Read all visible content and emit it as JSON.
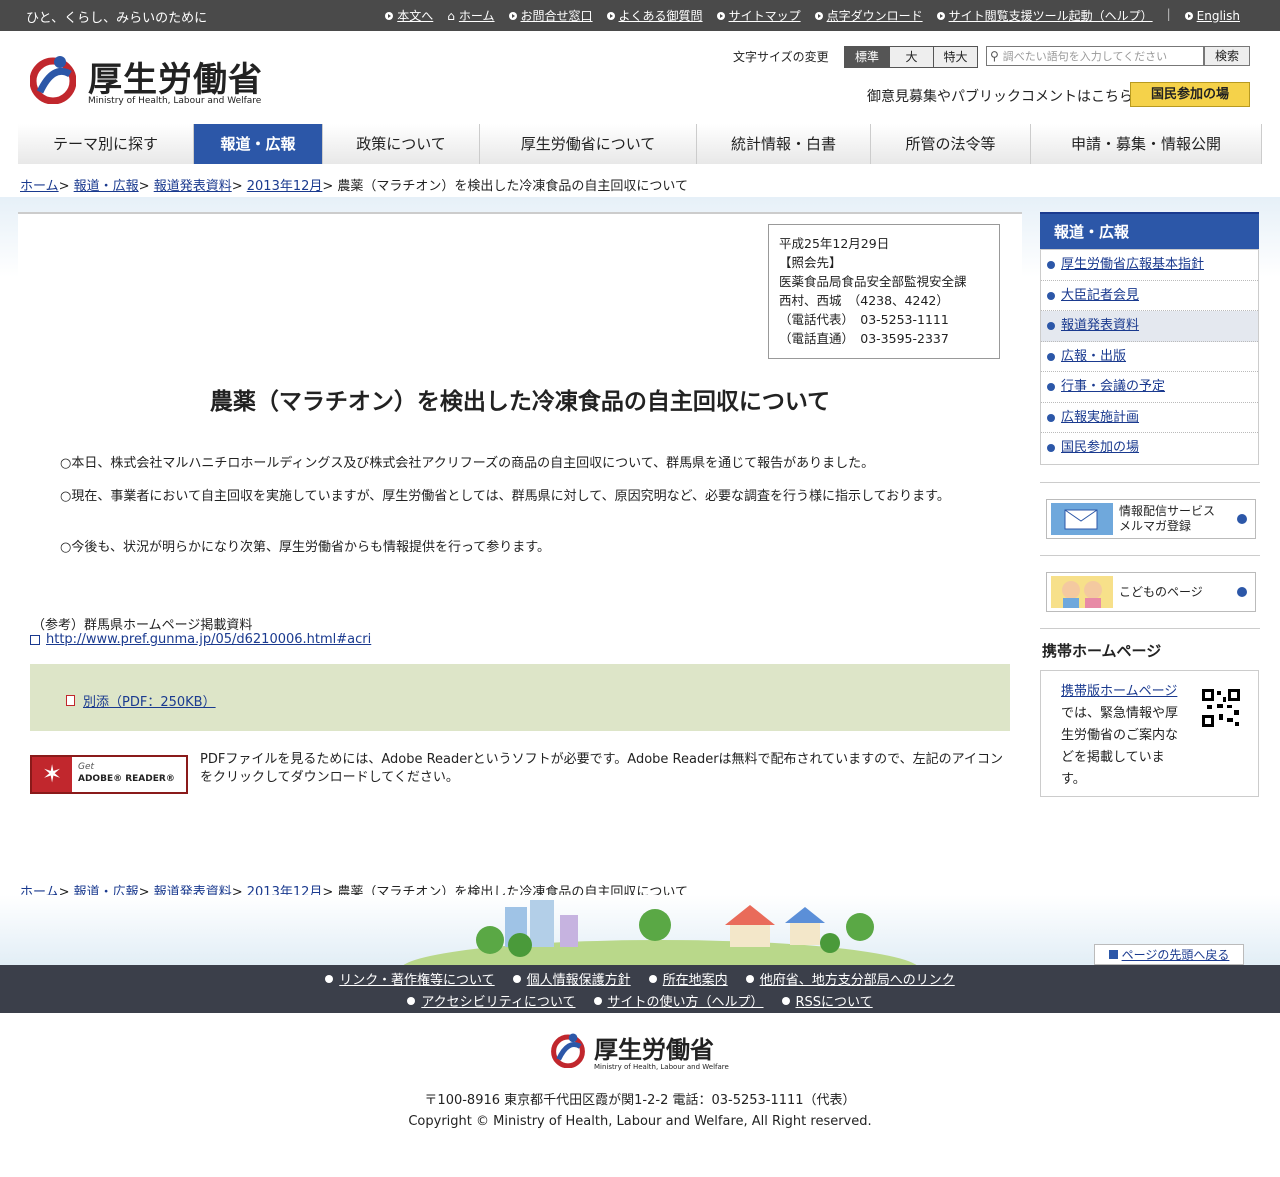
{
  "topbar": {
    "slogan": "ひと、くらし、みらいのために",
    "links": [
      "本文へ",
      "ホーム",
      "お問合せ窓口",
      "よくある御質問",
      "サイトマップ",
      "点字ダウンロード",
      "サイト閲覧支援ツール起動（ヘルプ）",
      "English"
    ]
  },
  "header": {
    "logo_text": "厚生労働省",
    "logo_sub": "Ministry of Health, Labour and Welfare",
    "fontsize_label": "文字サイズの変更",
    "fontsize_options": [
      "標準",
      "大",
      "特大"
    ],
    "search_placeholder": "調べたい語句を入力してください",
    "search_button": "検索",
    "opinion_text": "御意見募集やパブリックコメントはこちら",
    "opinion_button": "国民参加の場"
  },
  "nav": [
    "テーマ別に探す",
    "報道・広報",
    "政策について",
    "厚生労働省について",
    "統計情報・白書",
    "所管の法令等",
    "申請・募集・情報公開"
  ],
  "breadcrumb": {
    "items": [
      "ホーム",
      "報道・広報",
      "報道発表資料",
      "2013年12月"
    ],
    "current": "農薬（マラチオン）を検出した冷凍食品の自主回収について"
  },
  "info_box": {
    "date": "平成25年12月29日",
    "contact_label": "【照会先】",
    "department": "医薬食品局食品安全部監視安全課",
    "people": "西村、西城　（4238、4242）",
    "tel_main": "（電話代表）　03-5253-1111",
    "tel_direct": "（電話直通）　03-3595-2337"
  },
  "article": {
    "title": "農薬（マラチオン）を検出した冷凍食品の自主回収について",
    "p1": "○本日、株式会社マルハニチロホールディングス及び株式会社アクリフーズの商品の自主回収について、群馬県を通じて報告がありました。",
    "p2": "○現在、事業者において自主回収を実施していますが、厚生労働省としては、群馬県に対して、原因究明など、必要な調査を行う様に指示しております。",
    "p3": "○今後も、状況が明らかになり次第、厚生労働省からも情報提供を行って参ります。",
    "ref_label": "（参考）群馬県ホームページ掲載資料",
    "ref_link": "http://www.pref.gunma.jp/05/d6210006.html#acri",
    "attachment": "別添（PDF：250KB）",
    "reader_get": "Get",
    "reader_name": "ADOBE® READER®",
    "reader_text": "PDFファイルを見るためには、Adobe Readerというソフトが必要です。Adobe Readerは無料で配布されていますので、左記のアイコンをクリックしてダウンロードしてください。"
  },
  "sidebar": {
    "heading": "報道・広報",
    "items": [
      "厚生労働省広報基本指針",
      "大臣記者会見",
      "報道発表資料",
      "広報・出版",
      "行事・会議の予定",
      "広報実施計画",
      "国民参加の場"
    ],
    "banner1_line1": "情報配信サービス",
    "banner1_line2": "メルマガ登録",
    "banner2": "こどものページ",
    "mobile_title": "携帯ホームページ",
    "mobile_link": "携帯版ホームページ",
    "mobile_text": "では、緊急情報や厚生労働省のご案内などを掲載しています。"
  },
  "footer": {
    "pagetop": "ページの先頭へ戻る",
    "links_row1": [
      "リンク・著作権等について",
      "個人情報保護方針",
      "所在地案内",
      "他府省、地方支分部局へのリンク"
    ],
    "links_row2": [
      "アクセシビリティについて",
      "サイトの使い方（ヘルプ）",
      "RSSについて"
    ],
    "address": "〒100-8916 東京都千代田区霞が関1-2-2 電話：03-5253-1111（代表）",
    "copyright": "Copyright © Ministry of Health, Labour and Welfare, All Right reserved."
  },
  "colors": {
    "accent_blue": "#2c57a8",
    "accent_red": "#c1272d",
    "topbar": "#4a4a4a",
    "footer": "#3b3f4a"
  }
}
